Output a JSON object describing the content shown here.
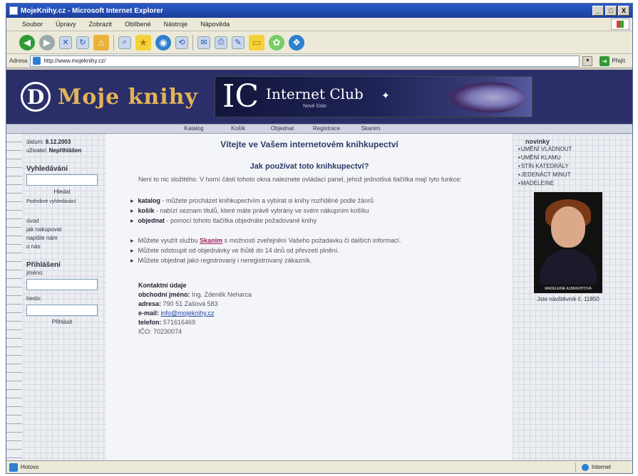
{
  "window": {
    "title": "MojeKnihy.cz - Microsoft Internet Explorer",
    "buttons": [
      "_",
      "□",
      "X"
    ]
  },
  "menu": [
    "Soubor",
    "Úpravy",
    "Zobrazit",
    "Oblíbené",
    "Nástroje",
    "Nápověda"
  ],
  "address": {
    "label": "Adresa",
    "url": "http://www.mojeknihy.cz/",
    "go_label": "Přejít"
  },
  "banner": {
    "logo_letter": "D",
    "site_name": "Moje knihy",
    "ad_letters": "IC",
    "ad_title": "Internet Club",
    "ad_subtitle": "Nové číslo"
  },
  "nav": [
    "Katalog",
    "Košík",
    "Objednat",
    "Registrace",
    "Skanim"
  ],
  "left": {
    "date_label": "datum:",
    "date_value": "8.12.2003",
    "user_label": "uživatel:",
    "user_value": "Nepřihlášen",
    "search_head": "Vyhledávání",
    "search_button": "Hledat",
    "advanced_search": "Podrobné vyhledávání",
    "links": [
      "úvod",
      "jak nakupovat",
      "napište nám",
      "o nás"
    ],
    "login_head": "Přihlášení",
    "login_name_label": "jméno:",
    "login_pass_label": "heslo:",
    "login_button": "Přihlásit"
  },
  "main": {
    "welcome": "Vítejte ve Vašem internetovém knihkupectví",
    "subtitle": "Jak používat toto knihkupectví?",
    "intro": "Není to nic složitého. V horní části tohoto okna naleznete ovládací panel, jehož jednotlivá tlačítka mají tyto funkce:",
    "functions": [
      {
        "key": "katalog",
        "text": " - můžete procházet knihkupectvím a vybírat si knihy rozříděné podle žánrů"
      },
      {
        "key": "košík",
        "text": " - nabízí seznam titulů, které máte právě vybrány ve svém nákupním košíku"
      },
      {
        "key": "objednat",
        "text": " - pomocí tohoto tlačítka objednáte požadované knihy"
      }
    ],
    "info_1_pre": "Můžete využít službu ",
    "info_1_link": "Skanim",
    "info_1_post": " s možností zveřejnění Vašeho požadavku či dalších informací.",
    "info_2": "Můžete odstoupit od objednávky ve lhůtě do 14 dnů od převzetí plnění.",
    "info_3": "Můžete objednat jako registrovaný i neregistrovaný zákazník.",
    "contact": {
      "head": "Kontaktní údaje",
      "company_label": "obchodní jméno:",
      "company_value": "Ing. Zdeněk Neharca",
      "address_label": "adresa:",
      "address_value": "790 51  Zašová 583",
      "email_label": "e-mail:",
      "email_value": "info@mojeknihy.cz",
      "phone_label": "telefon:",
      "phone_value": "571616469",
      "ico_label": "IČO:",
      "ico_value": "70230074"
    }
  },
  "right": {
    "head": "novinky",
    "books": [
      "UMĚNÍ VLÁDNOUT",
      "UMĚNÍ KLAMU",
      "STÍN KATEDRÁLY",
      "JEDENÁCT MINUT",
      "MADELEINE"
    ],
    "cover_caption": "MADELEINE ALBRIGHTOVÁ",
    "price": "Jste návštěvník č. 11850"
  },
  "status": {
    "text": "Hotovo",
    "zone": "Internet"
  }
}
